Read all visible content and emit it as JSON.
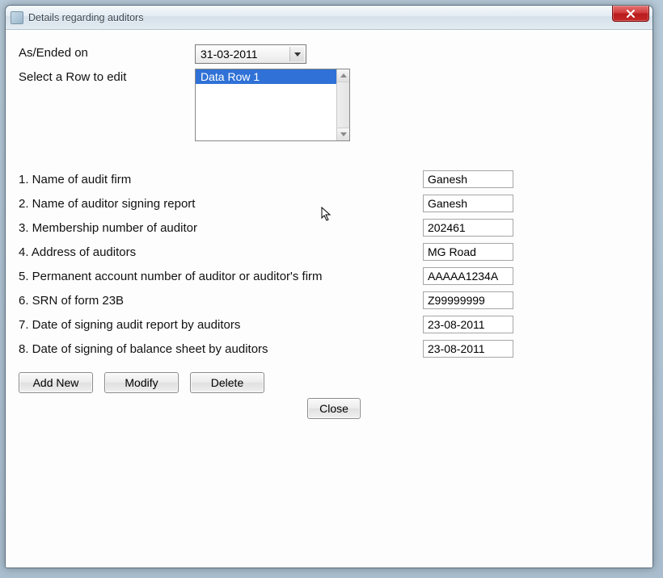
{
  "window": {
    "title": "Details regarding auditors"
  },
  "header": {
    "asOnLabel": "As/Ended on",
    "asOnValue": "31-03-2011",
    "selectRowLabel": "Select a Row to edit",
    "listItems": [
      "Data Row 1"
    ]
  },
  "fields": [
    {
      "label": "1. Name of audit firm",
      "value": "Ganesh"
    },
    {
      "label": "2. Name of auditor signing report",
      "value": "Ganesh"
    },
    {
      "label": "3. Membership number of auditor",
      "value": "202461"
    },
    {
      "label": "4. Address of auditors",
      "value": "MG Road"
    },
    {
      "label": "5. Permanent account number of auditor or auditor's firm",
      "value": "AAAAA1234A"
    },
    {
      "label": "6. SRN of form 23B",
      "value": "Z99999999"
    },
    {
      "label": "7. Date of signing audit report by auditors",
      "value": "23-08-2011"
    },
    {
      "label": "8. Date of signing of balance sheet by auditors",
      "value": "23-08-2011"
    }
  ],
  "buttons": {
    "addNew": "Add New",
    "modify": "Modify",
    "delete": "Delete",
    "close": "Close"
  }
}
